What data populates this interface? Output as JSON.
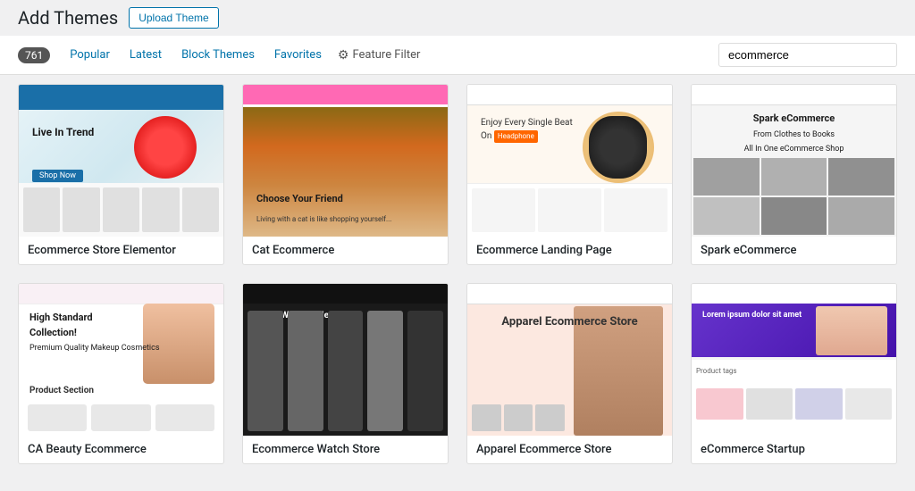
{
  "header": {
    "title": "Add Themes",
    "upload_btn": "Upload Theme"
  },
  "filter_bar": {
    "count": "761",
    "nav_items": [
      "Popular",
      "Latest",
      "Block Themes",
      "Favorites"
    ],
    "feature_filter": "Feature Filter",
    "search_placeholder": "ecommerce",
    "search_value": "ecommerce"
  },
  "themes": [
    {
      "id": 1,
      "name": "Ecommerce Store Elementor",
      "preview_type": "preview-1"
    },
    {
      "id": 2,
      "name": "Cat Ecommerce",
      "preview_type": "preview-2"
    },
    {
      "id": 3,
      "name": "Ecommerce Landing Page",
      "preview_type": "preview-3"
    },
    {
      "id": 4,
      "name": "Spark eCommerce",
      "preview_type": "preview-4"
    },
    {
      "id": 5,
      "name": "CA Beauty Ecommerce",
      "preview_type": "preview-5"
    },
    {
      "id": 6,
      "name": "Ecommerce Watch Store",
      "preview_type": "preview-6"
    },
    {
      "id": 7,
      "name": "Apparel Ecommerce Store",
      "preview_type": "preview-7"
    },
    {
      "id": 8,
      "name": "eCommerce Startup",
      "preview_type": "preview-8"
    }
  ]
}
